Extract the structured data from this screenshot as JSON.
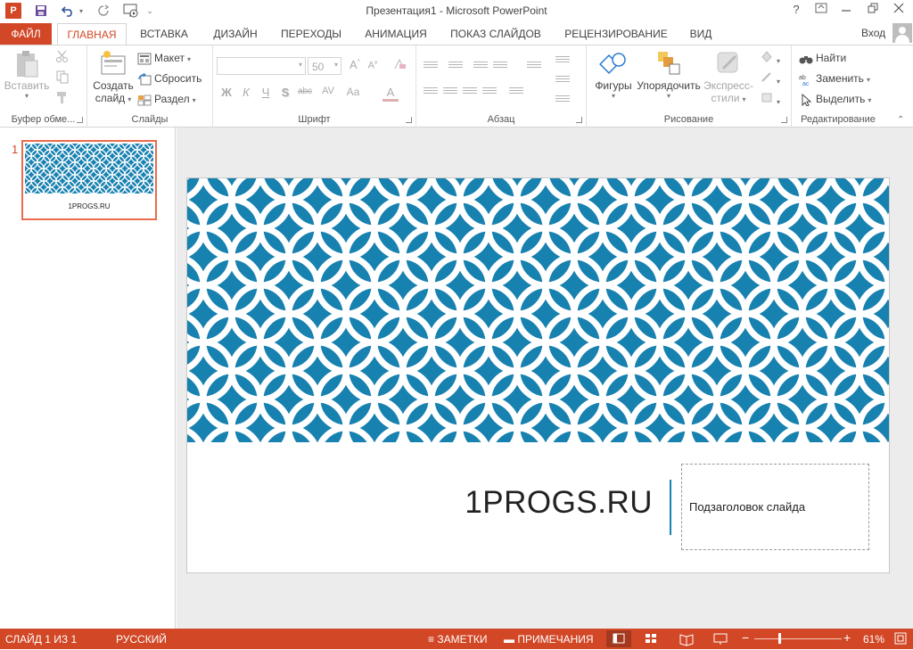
{
  "app": {
    "window_title": "Презентация1 - Microsoft PowerPoint",
    "icon_letter": "P",
    "login": "Вход",
    "help": "?"
  },
  "tabs": [
    "ФАЙЛ",
    "ГЛАВНАЯ",
    "ВСТАВКА",
    "ДИЗАЙН",
    "ПЕРЕХОДЫ",
    "АНИМАЦИЯ",
    "ПОКАЗ СЛАЙДОВ",
    "РЕЦЕНЗИРОВАНИЕ",
    "ВИД"
  ],
  "active_tab": "ГЛАВНАЯ",
  "ribbon": {
    "clipboard": {
      "label": "Буфер обме...",
      "paste": "Вставить"
    },
    "slides": {
      "label": "Слайды",
      "new_slide_1": "Создать",
      "new_slide_2": "слайд",
      "layout": "Макет",
      "reset": "Сбросить",
      "section": "Раздел"
    },
    "font": {
      "label": "Шрифт",
      "size": "50",
      "bold": "Ж",
      "italic": "К",
      "underline": "Ч",
      "shadow": "S",
      "strike": "abc",
      "spacing": "AV",
      "case": "Aa",
      "color": "A",
      "grow": "A",
      "shrink": "A"
    },
    "paragraph": {
      "label": "Абзац"
    },
    "drawing": {
      "label": "Рисование",
      "shapes": "Фигуры",
      "arrange": "Упорядочить",
      "quick_styles_1": "Экспресс-",
      "quick_styles_2": "стили"
    },
    "editing": {
      "label": "Редактирование",
      "find": "Найти",
      "replace": "Заменить",
      "select": "Выделить"
    }
  },
  "thumbnails": [
    {
      "number": "1",
      "title": "1PROGS.RU"
    }
  ],
  "slide": {
    "title": "1PROGS.RU",
    "subtitle": "Подзаголовок слайда"
  },
  "status": {
    "slide_info": "СЛАЙД 1 ИЗ 1",
    "language": "РУССКИЙ",
    "notes": "ЗАМЕТКИ",
    "comments": "ПРИМЕЧАНИЯ",
    "zoom": "61%",
    "zoom_level": 0.61
  },
  "colors": {
    "accent": "#d24726",
    "pattern_blue": "#1781b0",
    "divider": "#1781b0"
  }
}
